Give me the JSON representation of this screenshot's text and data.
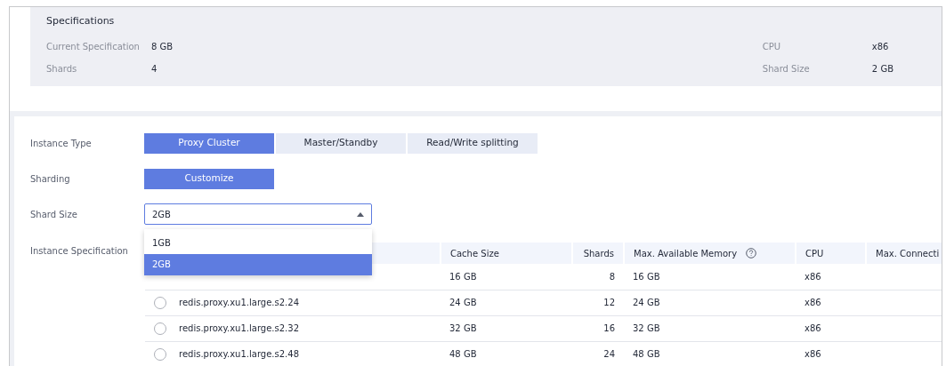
{
  "specifications": {
    "title": "Specifications",
    "items": [
      {
        "label": "Current Specification",
        "value": "8 GB"
      },
      {
        "label": "Shards",
        "value": "4"
      },
      {
        "label": "CPU",
        "value": "x86"
      },
      {
        "label": "Shard Size",
        "value": "2 GB"
      }
    ]
  },
  "form": {
    "instance_type": {
      "label": "Instance Type",
      "options": [
        {
          "label": "Proxy Cluster",
          "selected": true
        },
        {
          "label": "Master/Standby",
          "selected": false
        },
        {
          "label": "Read/Write splitting",
          "selected": false
        }
      ]
    },
    "sharding": {
      "label": "Sharding",
      "options": [
        {
          "label": "Customize",
          "selected": true
        }
      ]
    },
    "shard_size": {
      "label": "Shard Size",
      "value": "2GB",
      "expanded": true,
      "options": [
        {
          "label": "1GB",
          "selected": false
        },
        {
          "label": "2GB",
          "selected": true
        }
      ]
    },
    "instance_specification": {
      "label": "Instance Specification",
      "columns": [
        "Cache Size",
        "Shards",
        "Max. Available Memory",
        "CPU",
        "Max. Connecti"
      ],
      "rows": [
        {
          "cells": [
            "16 GB",
            "8",
            "16 GB",
            "x86"
          ]
        },
        {
          "selected": false,
          "name": "redis.proxy.xu1.large.s2.24",
          "cells": [
            "24 GB",
            "12",
            "24 GB",
            "x86"
          ]
        },
        {
          "selected": false,
          "name": "redis.proxy.xu1.large.s2.32",
          "cells": [
            "32 GB",
            "16",
            "32 GB",
            "x86"
          ]
        },
        {
          "selected": false,
          "name": "redis.proxy.xu1.large.s2.48",
          "cells": [
            "48 GB",
            "24",
            "48 GB",
            "x86"
          ]
        }
      ]
    }
  }
}
